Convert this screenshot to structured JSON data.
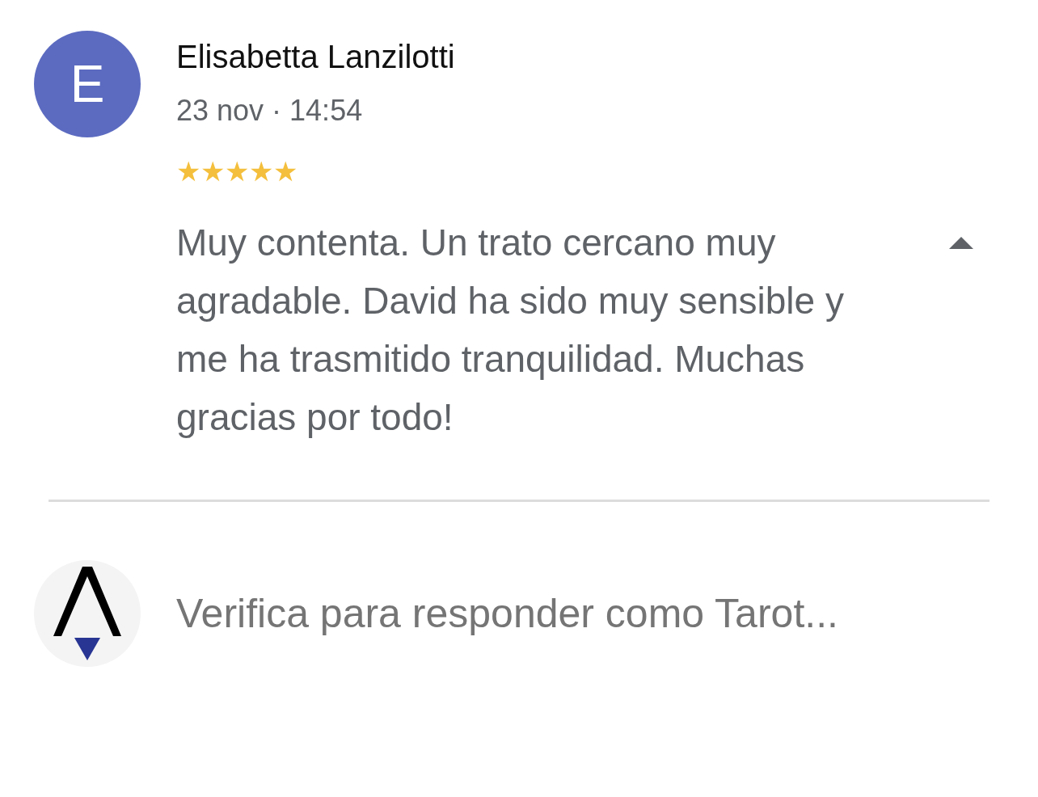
{
  "review": {
    "avatar_letter": "E",
    "author": "Elisabetta Lanzilotti",
    "date": "23 nov · 14:54",
    "stars": 5,
    "text": "Muy contenta. Un trato cercano muy agradable. David ha sido muy sensible y me ha trasmitido tranquilidad. Muchas gracias por todo!",
    "expanded": true
  },
  "reply": {
    "placeholder": "Verifica para responder como Tarot..."
  }
}
